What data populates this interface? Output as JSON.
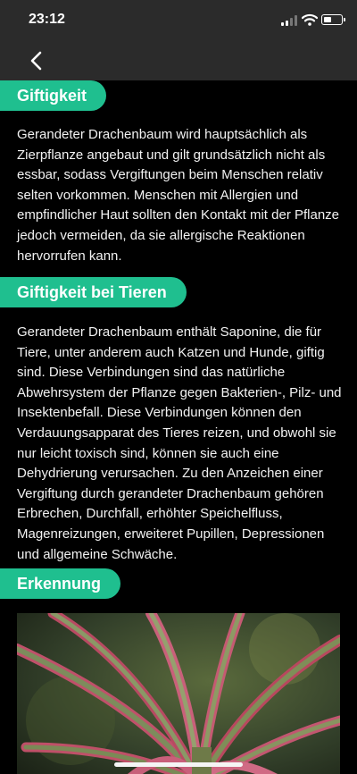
{
  "status_bar": {
    "time": "23:12",
    "icons": [
      "cellular-signal-icon",
      "wifi-icon",
      "battery-icon"
    ],
    "battery_level": 0.45
  },
  "nav": {
    "back_icon": "chevron-left-icon"
  },
  "colors": {
    "accent": "#1fbf8f",
    "background": "#000000",
    "bar": "#2b2b2b"
  },
  "sections": [
    {
      "title": "Giftigkeit",
      "text": "Gerandeter Drachenbaum wird hauptsächlich als Zierpflanze angebaut und gilt grundsätzlich nicht als essbar, sodass Vergiftungen beim Menschen relativ selten vorkommen. Menschen mit Allergien und empfindlicher Haut sollten den Kontakt mit der Pflanze jedoch vermeiden, da sie allergische Reaktionen hervorrufen kann."
    },
    {
      "title": "Giftigkeit bei Tieren",
      "text": "Gerandeter Drachenbaum enthält Saponine, die für Tiere, unter anderem auch Katzen und Hunde, giftig sind. Diese Verbindungen sind das natürliche Abwehrsystem der Pflanze gegen Bakterien-, Pilz- und Insektenbefall. Diese Verbindungen können den Verdauungsapparat des Tieres reizen, und obwohl sie nur leicht toxisch sind, können sie auch eine Dehydrierung verursachen. Zu den Anzeichen einer Vergiftung durch gerandeter Drachenbaum gehören Erbrechen, Durchfall, erhöhter Speichelfluss, Magenreizungen, erweiteret Pupillen, Depressionen und allgemeine Schwäche."
    },
    {
      "title": "Erkennung"
    }
  ]
}
